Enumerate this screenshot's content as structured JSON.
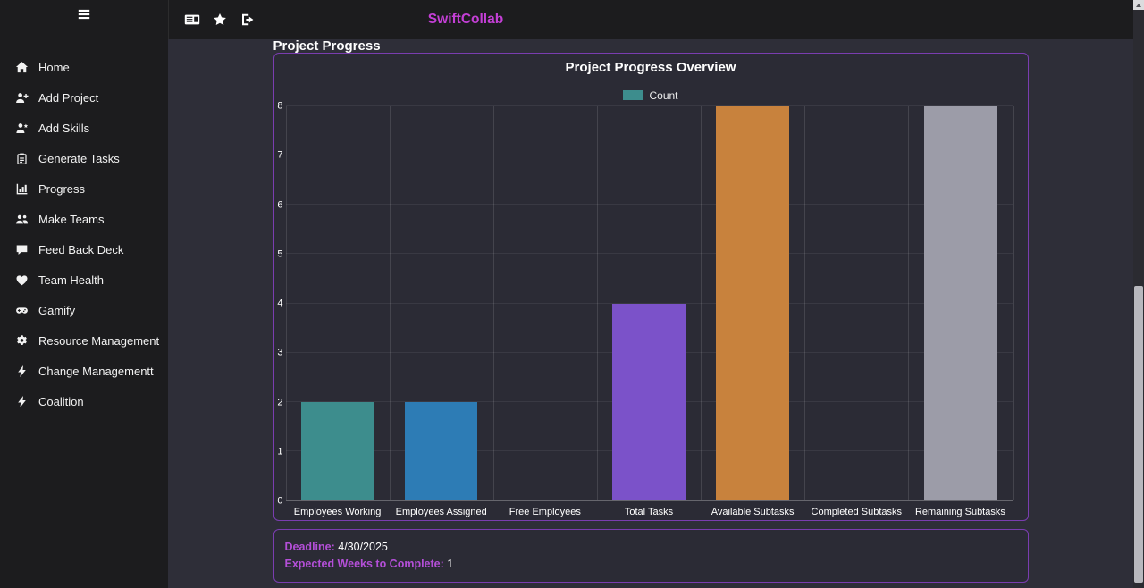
{
  "colors": {
    "brand": "#c43fd6",
    "accent_border": "#7a3db0",
    "label_purple": "#b44fd8",
    "sidebar_bg": "#1c1c1e",
    "main_bg": "#2e2e38",
    "card_bg": "#2b2b35"
  },
  "topbar": {
    "title": "SwiftCollab",
    "icons": [
      {
        "name": "news-feed-icon"
      },
      {
        "name": "star-icon"
      },
      {
        "name": "sign-out-icon"
      }
    ]
  },
  "sidebar": {
    "menu_icon": "menu-icon",
    "items": [
      {
        "label": "Home",
        "icon": "home-icon"
      },
      {
        "label": "Add Project",
        "icon": "user-plus-icon"
      },
      {
        "label": "Add Skills",
        "icon": "user-skill-icon"
      },
      {
        "label": "Generate Tasks",
        "icon": "clipboard-icon"
      },
      {
        "label": "Progress",
        "icon": "chart-bar-icon"
      },
      {
        "label": "Make Teams",
        "icon": "users-icon"
      },
      {
        "label": "Feed Back Deck",
        "icon": "comment-icon"
      },
      {
        "label": "Team Health",
        "icon": "heart-icon"
      },
      {
        "label": "Gamify",
        "icon": "gamepad-icon"
      },
      {
        "label": "Resource Management",
        "icon": "gear-icon"
      },
      {
        "label": "Change Managementt",
        "icon": "bolt-icon"
      },
      {
        "label": "Coalition",
        "icon": "bolt-icon"
      }
    ]
  },
  "main": {
    "heading": "Project Progress",
    "info": {
      "deadline_label": "Deadline:",
      "deadline_value": "4/30/2025",
      "weeks_label": "Expected Weeks to Complete:",
      "weeks_value": "1"
    }
  },
  "chart_data": {
    "type": "bar",
    "title": "Project Progress Overview",
    "legend": [
      {
        "label": "Count",
        "color": "#3d8d8d"
      }
    ],
    "legend_position": "top",
    "categories": [
      "Employees Working",
      "Employees Assigned",
      "Free Employees",
      "Total Tasks",
      "Available Subtasks",
      "Completed Subtasks",
      "Remaining Subtasks"
    ],
    "values": [
      2,
      2,
      0,
      4,
      8,
      0,
      8
    ],
    "bar_colors": [
      "#3d8d8d",
      "#2d7cb5",
      "#3d8d8d",
      "#7b52c9",
      "#c8823d",
      "#3d8d8d",
      "#9c9ca8"
    ],
    "xlabel": "",
    "ylabel": "",
    "ylim": [
      0,
      8
    ],
    "yticks": [
      0,
      1,
      2,
      3,
      4,
      5,
      6,
      7,
      8
    ],
    "grid": true
  }
}
